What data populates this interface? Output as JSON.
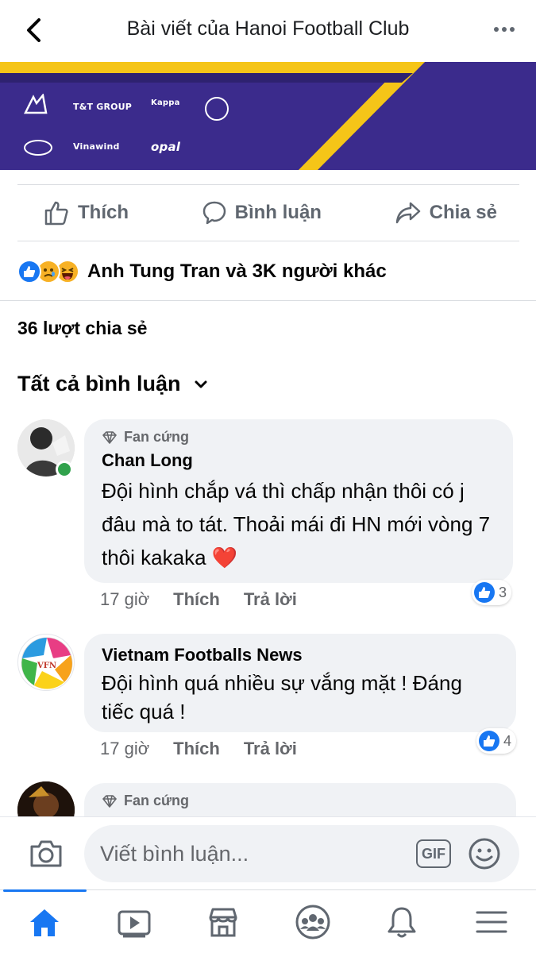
{
  "header": {
    "title": "Bài viết của Hanoi Football Club",
    "back_icon": "chevron-left-icon",
    "more_icon": "more-horizontal-icon"
  },
  "banner": {
    "sponsors": [
      "BAMBOO AIRWAYS",
      "T&T GROUP",
      "Kappa",
      "Vinawind",
      "opal"
    ],
    "colors": {
      "purple": "#3b2b8c",
      "yellow": "#f5c518"
    }
  },
  "actions": {
    "like": "Thích",
    "comment": "Bình luận",
    "share": "Chia sẻ"
  },
  "reactions": {
    "icons": [
      "like-reaction",
      "sad-reaction",
      "haha-reaction"
    ],
    "text": "Anh Tung Tran và 3K người khác"
  },
  "shares": "36 lượt chia sẻ",
  "comments_header": "Tất cả bình luận",
  "comments": [
    {
      "badge": "Fan cứng",
      "author": "Chan Long",
      "text": "Đội hình chắp vá thì chấp nhận thôi có j đâu mà to tát. Thoải mái đi HN mới vòng 7 thôi kakaka",
      "emoji": "❤️",
      "time": "17 giờ",
      "like_label": "Thích",
      "reply_label": "Trả lời",
      "likes": "3",
      "online": true
    },
    {
      "author": "Vietnam Footballs News",
      "text": "Đội hình quá nhiều sự vắng mặt ! Đáng tiếc quá !",
      "time": "17 giờ",
      "like_label": "Thích",
      "reply_label": "Trả lời",
      "likes": "4",
      "avatar_text": "VFN"
    },
    {
      "badge": "Fan cứng"
    }
  ],
  "composer": {
    "placeholder": "Viết bình luận...",
    "gif_label": "GIF"
  },
  "bottom_nav": [
    "home-icon",
    "watch-icon",
    "marketplace-icon",
    "groups-icon",
    "notifications-icon",
    "menu-icon"
  ],
  "colors": {
    "accent": "#1877f2",
    "bubble": "#f0f2f5",
    "online": "#31a24c"
  }
}
